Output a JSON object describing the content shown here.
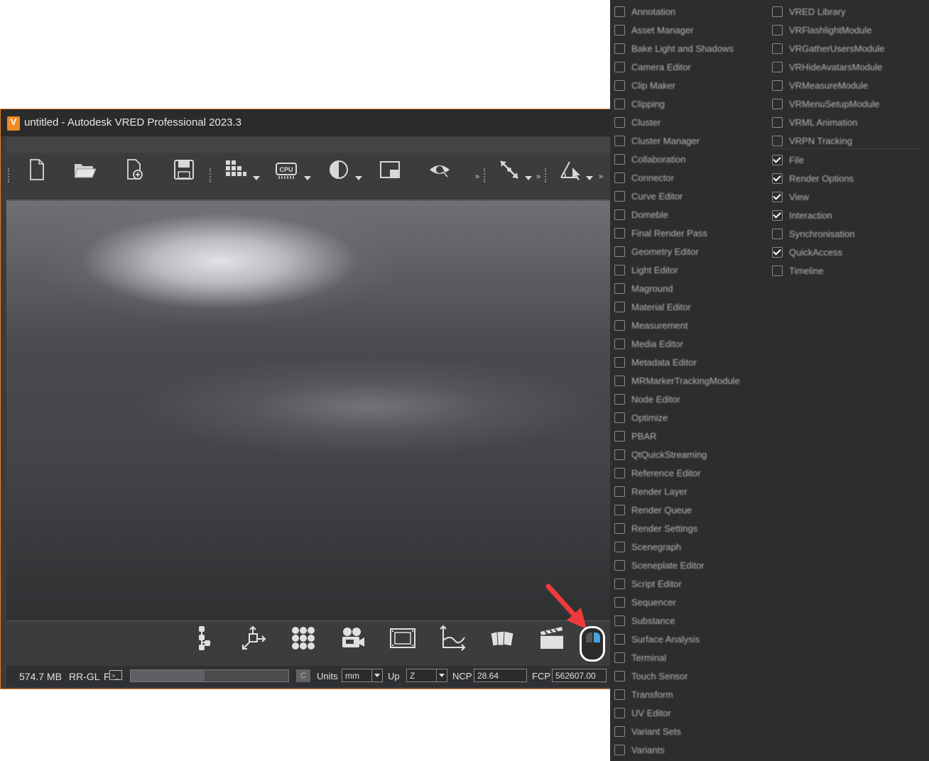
{
  "window": {
    "title": "untitled - Autodesk VRED Professional 2023.3",
    "logo_letter": "V"
  },
  "toolbar": {
    "icons": [
      "new-file",
      "open-folder",
      "add-file",
      "save",
      "render-grid",
      "cpu",
      "contrast",
      "window-split",
      "eye",
      "transform-arrows",
      "angle-measure"
    ],
    "overflow_chevron": "»"
  },
  "bottom_toolbar": {
    "icons": [
      "scenegraph",
      "transform",
      "material-grid",
      "camera",
      "render-film",
      "curve",
      "cards",
      "clapperboard",
      "mouse"
    ]
  },
  "status": {
    "memory": "574.7 MB",
    "renderer": "RR-GL",
    "f_label": "F",
    "terminal_icon": ">_",
    "c_button": "C",
    "units_label": "Units",
    "units_value": "mm",
    "up_label": "Up",
    "up_value": "Z",
    "ncp_label": "NCP",
    "ncp_value": "28.64",
    "fcp_label": "FCP",
    "fcp_value": "562607.00",
    "progress_fraction": 0.47
  },
  "colors": {
    "accent": "#e8832a",
    "highlight_arrow": "#ef3b3b",
    "mouse_right_button": "#4aa3df"
  },
  "panel": {
    "left_column": [
      {
        "label": "Annotation",
        "checked": false
      },
      {
        "label": "Asset Manager",
        "checked": false
      },
      {
        "label": "Bake Light and Shadows",
        "checked": false
      },
      {
        "label": "Camera Editor",
        "checked": false
      },
      {
        "label": "Clip Maker",
        "checked": false
      },
      {
        "label": "Clipping",
        "checked": false
      },
      {
        "label": "Cluster",
        "checked": false
      },
      {
        "label": "Cluster Manager",
        "checked": false
      },
      {
        "label": "Collaboration",
        "checked": false
      },
      {
        "label": "Connector",
        "checked": false
      },
      {
        "label": "Curve Editor",
        "checked": false
      },
      {
        "label": "Domeble",
        "checked": false
      },
      {
        "label": "Final Render Pass",
        "checked": false
      },
      {
        "label": "Geometry Editor",
        "checked": false
      },
      {
        "label": "Light Editor",
        "checked": false
      },
      {
        "label": "Maground",
        "checked": false
      },
      {
        "label": "Material Editor",
        "checked": false
      },
      {
        "label": "Measurement",
        "checked": false
      },
      {
        "label": "Media Editor",
        "checked": false
      },
      {
        "label": "Metadata Editor",
        "checked": false
      },
      {
        "label": "MRMarkerTrackingModule",
        "checked": false
      },
      {
        "label": "Node Editor",
        "checked": false
      },
      {
        "label": "Optimize",
        "checked": false
      },
      {
        "label": "PBAR",
        "checked": false
      },
      {
        "label": "QtQuickStreaming",
        "checked": false
      },
      {
        "label": "Reference Editor",
        "checked": false
      },
      {
        "label": "Render Layer",
        "checked": false
      },
      {
        "label": "Render Queue",
        "checked": false
      },
      {
        "label": "Render Settings",
        "checked": false
      },
      {
        "label": "Scenegraph",
        "checked": false
      },
      {
        "label": "Sceneplate Editor",
        "checked": false
      },
      {
        "label": "Script Editor",
        "checked": false
      },
      {
        "label": "Sequencer",
        "checked": false
      },
      {
        "label": "Substance",
        "checked": false
      },
      {
        "label": "Surface Analysis",
        "checked": false
      },
      {
        "label": "Terminal",
        "checked": false
      },
      {
        "label": "Touch Sensor",
        "checked": false
      },
      {
        "label": "Transform",
        "checked": false
      },
      {
        "label": "UV Editor",
        "checked": false
      },
      {
        "label": "Variant Sets",
        "checked": false
      },
      {
        "label": "Variants",
        "checked": false
      }
    ],
    "right_column_modules": [
      {
        "label": "VRED Library",
        "checked": false
      },
      {
        "label": "VRFlashlightModule",
        "checked": false
      },
      {
        "label": "VRGatherUsersModule",
        "checked": false
      },
      {
        "label": "VRHideAvatarsModule",
        "checked": false
      },
      {
        "label": "VRMeasureModule",
        "checked": false
      },
      {
        "label": "VRMenuSetupModule",
        "checked": false
      },
      {
        "label": "VRML Animation",
        "checked": false
      },
      {
        "label": "VRPN Tracking",
        "checked": false
      }
    ],
    "right_column_toolbars": [
      {
        "label": "File",
        "checked": true
      },
      {
        "label": "Render Options",
        "checked": true
      },
      {
        "label": "View",
        "checked": true
      },
      {
        "label": "Interaction",
        "checked": true
      },
      {
        "label": "Synchronisation",
        "checked": false
      },
      {
        "label": "QuickAccess",
        "checked": true
      },
      {
        "label": "Timeline",
        "checked": false
      }
    ]
  }
}
